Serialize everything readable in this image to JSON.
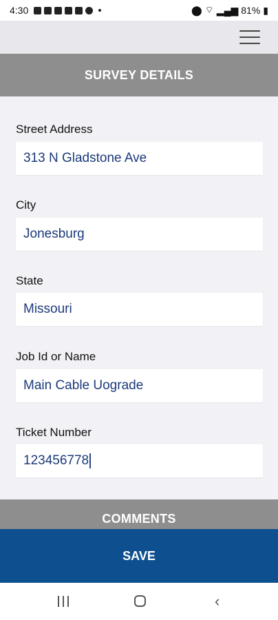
{
  "status_bar": {
    "time": "4:30",
    "battery": "81%"
  },
  "survey_header": "SURVEY DETAILS",
  "fields": {
    "street_address": {
      "label": "Street Address",
      "value": "313 N Gladstone Ave"
    },
    "city": {
      "label": "City",
      "value": "Jonesburg"
    },
    "state": {
      "label": "State",
      "value": "Missouri"
    },
    "job": {
      "label": "Job Id or Name",
      "value": "Main Cable Uograde"
    },
    "ticket": {
      "label": "Ticket Number",
      "value": "123456778"
    }
  },
  "comments_header": "COMMENTS",
  "save_label": "SAVE",
  "colors": {
    "primary": "#0e4f8f",
    "section_header": "#8e8e8e",
    "input_text": "#1b3a7a"
  }
}
